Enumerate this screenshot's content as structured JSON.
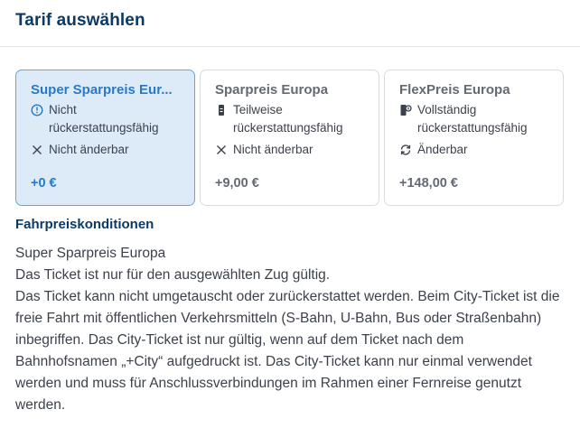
{
  "header": {
    "title": "Tarif auswählen"
  },
  "tariffs": [
    {
      "title": "Super Sparpreis Eur...",
      "selected": true,
      "features": [
        {
          "icon": "info-circle-icon",
          "text": "Nicht rückerstattungsfähig"
        },
        {
          "icon": "close-icon",
          "text": "Nicht änderbar"
        }
      ],
      "price": "+0 €"
    },
    {
      "title": "Sparpreis Europa",
      "selected": false,
      "features": [
        {
          "icon": "ticket-icon",
          "text": "Teilweise rückerstattungsfähig"
        },
        {
          "icon": "close-icon",
          "text": "Nicht änderbar"
        }
      ],
      "price": "+9,00 €"
    },
    {
      "title": "FlexPreis Europa",
      "selected": false,
      "features": [
        {
          "icon": "refund-icon",
          "text": "Vollständig rückerstattungsfähig"
        },
        {
          "icon": "exchange-icon",
          "text": "Änderbar"
        }
      ],
      "price": "+148,00 €"
    }
  ],
  "conditions": {
    "title": "Fahrpreiskonditionen",
    "lines": [
      "Super Sparpreis Europa",
      "Das Ticket ist nur für den ausgewählten Zug gültig.",
      "Das Ticket kann nicht umgetauscht oder zurückerstattet werden. Beim City-Ticket ist die freie Fahrt mit öffentlichen Verkehrsmitteln (S-Bahn, U-Bahn, Bus oder Straßenbahn) inbegriffen. Das City-Ticket ist nur gültig, wenn auf dem Ticket nach dem Bahnhofsnamen „+City“ aufgedruckt ist. Das City-Ticket kann nur einmal verwendet werden und muss für Anschlussverbindungen im Rahmen einer Fernreise genutzt werden."
    ]
  },
  "colors": {
    "heading": "#0c3a66",
    "accent": "#2a79c9",
    "selected_bg": "#ddebf8",
    "border": "#d7dce1"
  }
}
